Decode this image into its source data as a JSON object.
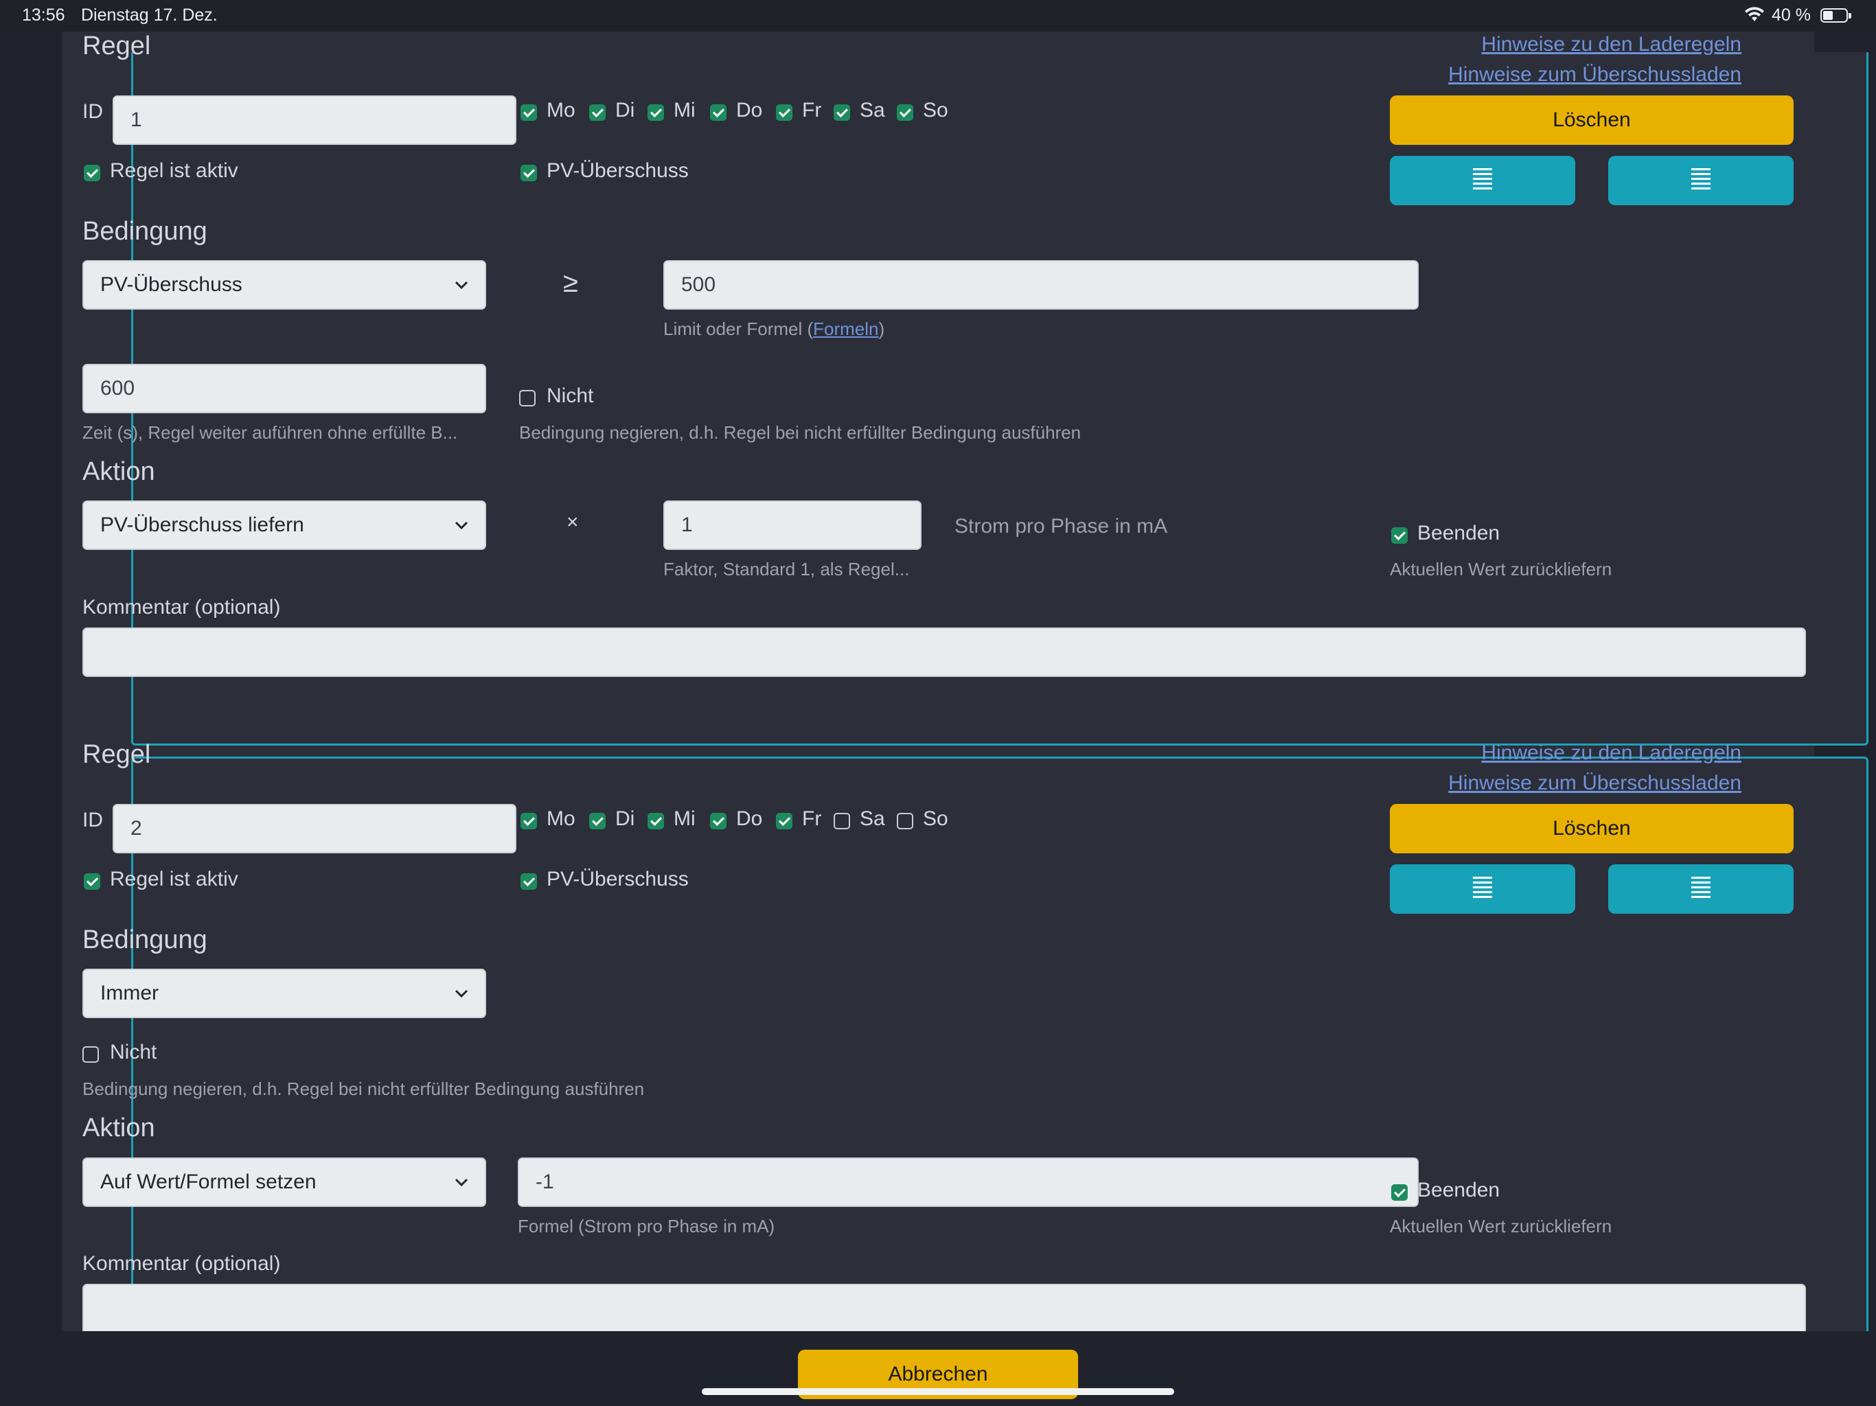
{
  "status_bar": {
    "time": "13:56",
    "date": "Dienstag 17. Dez.",
    "battery": "40 %"
  },
  "links": {
    "charge_rules": "Hinweise zu den Laderegeln",
    "surplus": "Hinweise zum Überschussladen"
  },
  "rules": [
    {
      "heading": "Regel",
      "id_label": "ID",
      "id_value": "1",
      "days": [
        {
          "label": "Mo",
          "checked": true
        },
        {
          "label": "Di",
          "checked": true
        },
        {
          "label": "Mi",
          "checked": true
        },
        {
          "label": "Do",
          "checked": true
        },
        {
          "label": "Fr",
          "checked": true
        },
        {
          "label": "Sa",
          "checked": true
        },
        {
          "label": "So",
          "checked": true
        }
      ],
      "active_label": "Regel ist aktiv",
      "pv_label": "PV-Überschuss",
      "delete_label": "Löschen",
      "condition_heading": "Bedingung",
      "condition_select": "PV-Überschuss",
      "operator": "≥",
      "limit_value": "500",
      "limit_hint_prefix": "Limit oder Formel (",
      "limit_hint_link": "Formeln",
      "limit_hint_suffix": ")",
      "time_value": "600",
      "time_hint": "Zeit (s), Regel weiter auführen ohne erfüllte B...",
      "not_label": "Nicht",
      "not_hint": "Bedingung negieren, d.h. Regel bei nicht erfüllter Bedingung ausführen",
      "action_heading": "Aktion",
      "action_select": "PV-Überschuss liefern",
      "action_operator": "×",
      "factor_value": "1",
      "factor_hint": "Faktor, Standard 1, als Regel...",
      "unit_text": "Strom pro Phase in mA",
      "end_label": "Beenden",
      "end_hint": "Aktuellen Wert zurückliefern",
      "comment_label": "Kommentar (optional)"
    },
    {
      "heading": "Regel",
      "id_label": "ID",
      "id_value": "2",
      "days": [
        {
          "label": "Mo",
          "checked": true
        },
        {
          "label": "Di",
          "checked": true
        },
        {
          "label": "Mi",
          "checked": true
        },
        {
          "label": "Do",
          "checked": true
        },
        {
          "label": "Fr",
          "checked": true
        },
        {
          "label": "Sa",
          "checked": false
        },
        {
          "label": "So",
          "checked": false
        }
      ],
      "active_label": "Regel ist aktiv",
      "pv_label": "PV-Überschuss",
      "delete_label": "Löschen",
      "condition_heading": "Bedingung",
      "condition_select": "Immer",
      "not_label": "Nicht",
      "not_hint": "Bedingung negieren, d.h. Regel bei nicht erfüllter Bedingung ausführen",
      "action_heading": "Aktion",
      "action_select": "Auf Wert/Formel setzen",
      "formula_value": "-1",
      "formula_hint": "Formel (Strom pro Phase in mA)",
      "end_label": "Beenden",
      "end_hint": "Aktuellen Wert zurückliefern",
      "comment_label": "Kommentar (optional)"
    }
  ],
  "cancel_label": "Abbrechen"
}
